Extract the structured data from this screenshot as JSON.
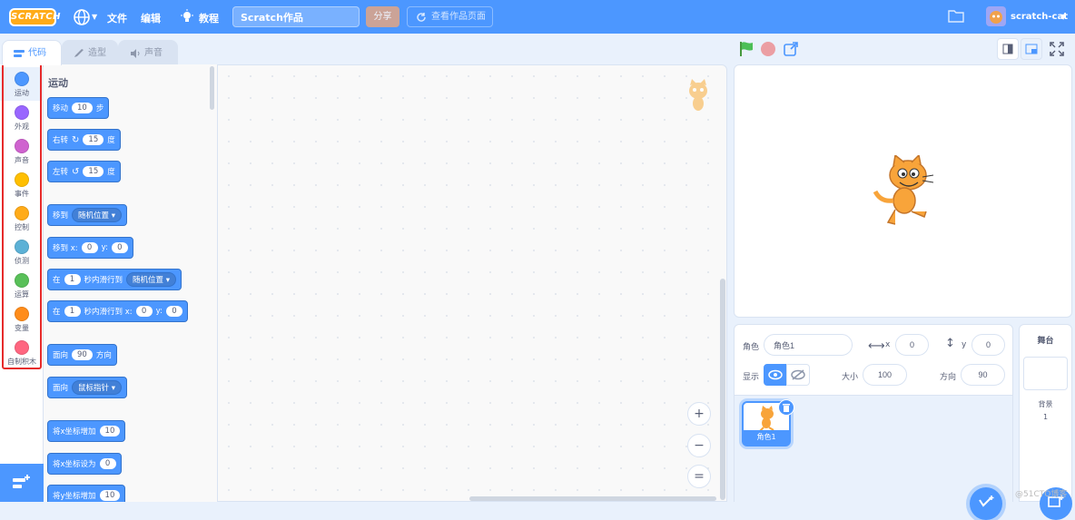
{
  "menubar": {
    "logo": "SCRATCH",
    "file": "文件",
    "edit": "编辑",
    "tutorials": "教程",
    "project_title": "Scratch作品",
    "share": "分享",
    "see_project": "查看作品页面",
    "username": "scratch-cat"
  },
  "tabs": {
    "code": "代码",
    "costumes": "造型",
    "sounds": "声音"
  },
  "categories": [
    {
      "label": "运动",
      "color": "#4c97ff"
    },
    {
      "label": "外观",
      "color": "#9966ff"
    },
    {
      "label": "声音",
      "color": "#cf63cf"
    },
    {
      "label": "事件",
      "color": "#ffbf00"
    },
    {
      "label": "控制",
      "color": "#ffab19"
    },
    {
      "label": "侦测",
      "color": "#5cb1d6"
    },
    {
      "label": "运算",
      "color": "#59c059"
    },
    {
      "label": "变量",
      "color": "#ff8c1a"
    },
    {
      "label": "自制积木",
      "color": "#ff6680"
    }
  ],
  "palette": {
    "heading": "运动",
    "move": {
      "a": "移动",
      "v": "10",
      "b": "步"
    },
    "turn_right": {
      "a": "右转",
      "v": "15",
      "b": "度"
    },
    "turn_left": {
      "a": "左转",
      "v": "15",
      "b": "度"
    },
    "goto": {
      "a": "移到",
      "dd": "随机位置"
    },
    "goto_xy": {
      "a": "移到 x:",
      "x": "0",
      "b": "y:",
      "y": "0"
    },
    "glide": {
      "a": "在",
      "v": "1",
      "b": "秒内滑行到",
      "dd": "随机位置"
    },
    "glide_xy": {
      "a": "在",
      "v": "1",
      "b": "秒内滑行到 x:",
      "x": "0",
      "c": "y:",
      "y": "0"
    },
    "point_dir": {
      "a": "面向",
      "v": "90",
      "b": "方向"
    },
    "point_towards": {
      "a": "面向",
      "dd": "鼠标指针"
    },
    "change_x": {
      "a": "将x坐标增加",
      "v": "10"
    },
    "set_x": {
      "a": "将x坐标设为",
      "v": "0"
    },
    "change_y": {
      "a": "将y坐标增加",
      "v": "10"
    }
  },
  "zoom": {
    "in": "+",
    "out": "−",
    "reset": "="
  },
  "sprite_info": {
    "sprite_label": "角色",
    "sprite_name": "角色1",
    "x_label": "x",
    "x_value": "0",
    "y_label": "y",
    "y_value": "0",
    "show_label": "显示",
    "size_label": "大小",
    "size_value": "100",
    "direction_label": "方向",
    "direction_value": "90"
  },
  "sprite_list": [
    {
      "name": "角色1"
    }
  ],
  "stage_panel": {
    "title": "舞台",
    "backdrops_label": "背景",
    "backdrops_count": "1"
  },
  "watermark": "@51CTO博客"
}
